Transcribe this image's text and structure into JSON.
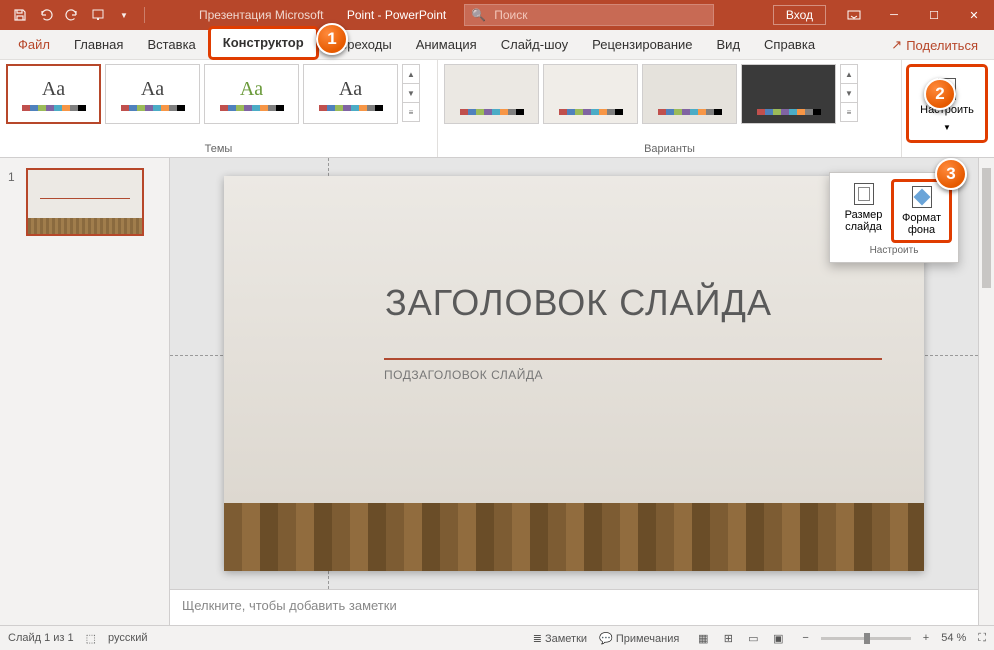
{
  "titlebar": {
    "doc_title": "Презентация Microsoft",
    "app_name": "Point - PowerPoint",
    "search_placeholder": "Поиск",
    "login": "Вход"
  },
  "menu": {
    "file": "Файл",
    "home": "Главная",
    "insert": "Вставка",
    "design": "Конструктор",
    "transitions": "Переходы",
    "animations": "Анимация",
    "slideshow": "Слайд-шоу",
    "review": "Рецензирование",
    "view": "Вид",
    "help": "Справка",
    "share": "Поделиться"
  },
  "ribbon": {
    "themes_label": "Темы",
    "variants_label": "Варианты",
    "customize": "Настроить",
    "slide_size": "Размер слайда",
    "format_bg": "Формат фона",
    "customize_group": "Настроить"
  },
  "thumb": {
    "num": "1"
  },
  "slide": {
    "title": "ЗАГОЛОВОК СЛАЙДА",
    "subtitle": "ПОДЗАГОЛОВОК СЛАЙДА"
  },
  "notes": {
    "placeholder": "Щелкните, чтобы добавить заметки"
  },
  "status": {
    "slide_info": "Слайд 1 из 1",
    "language": "русский",
    "notes_btn": "Заметки",
    "comments_btn": "Примечания",
    "zoom": "54 %"
  },
  "callouts": {
    "c1": "1",
    "c2": "2",
    "c3": "3"
  },
  "theme_colors": [
    "#c0504d",
    "#4f81bd",
    "#9bbb59",
    "#8064a2",
    "#4bacc6",
    "#f79646",
    "#7f7f7f",
    "#000000"
  ]
}
